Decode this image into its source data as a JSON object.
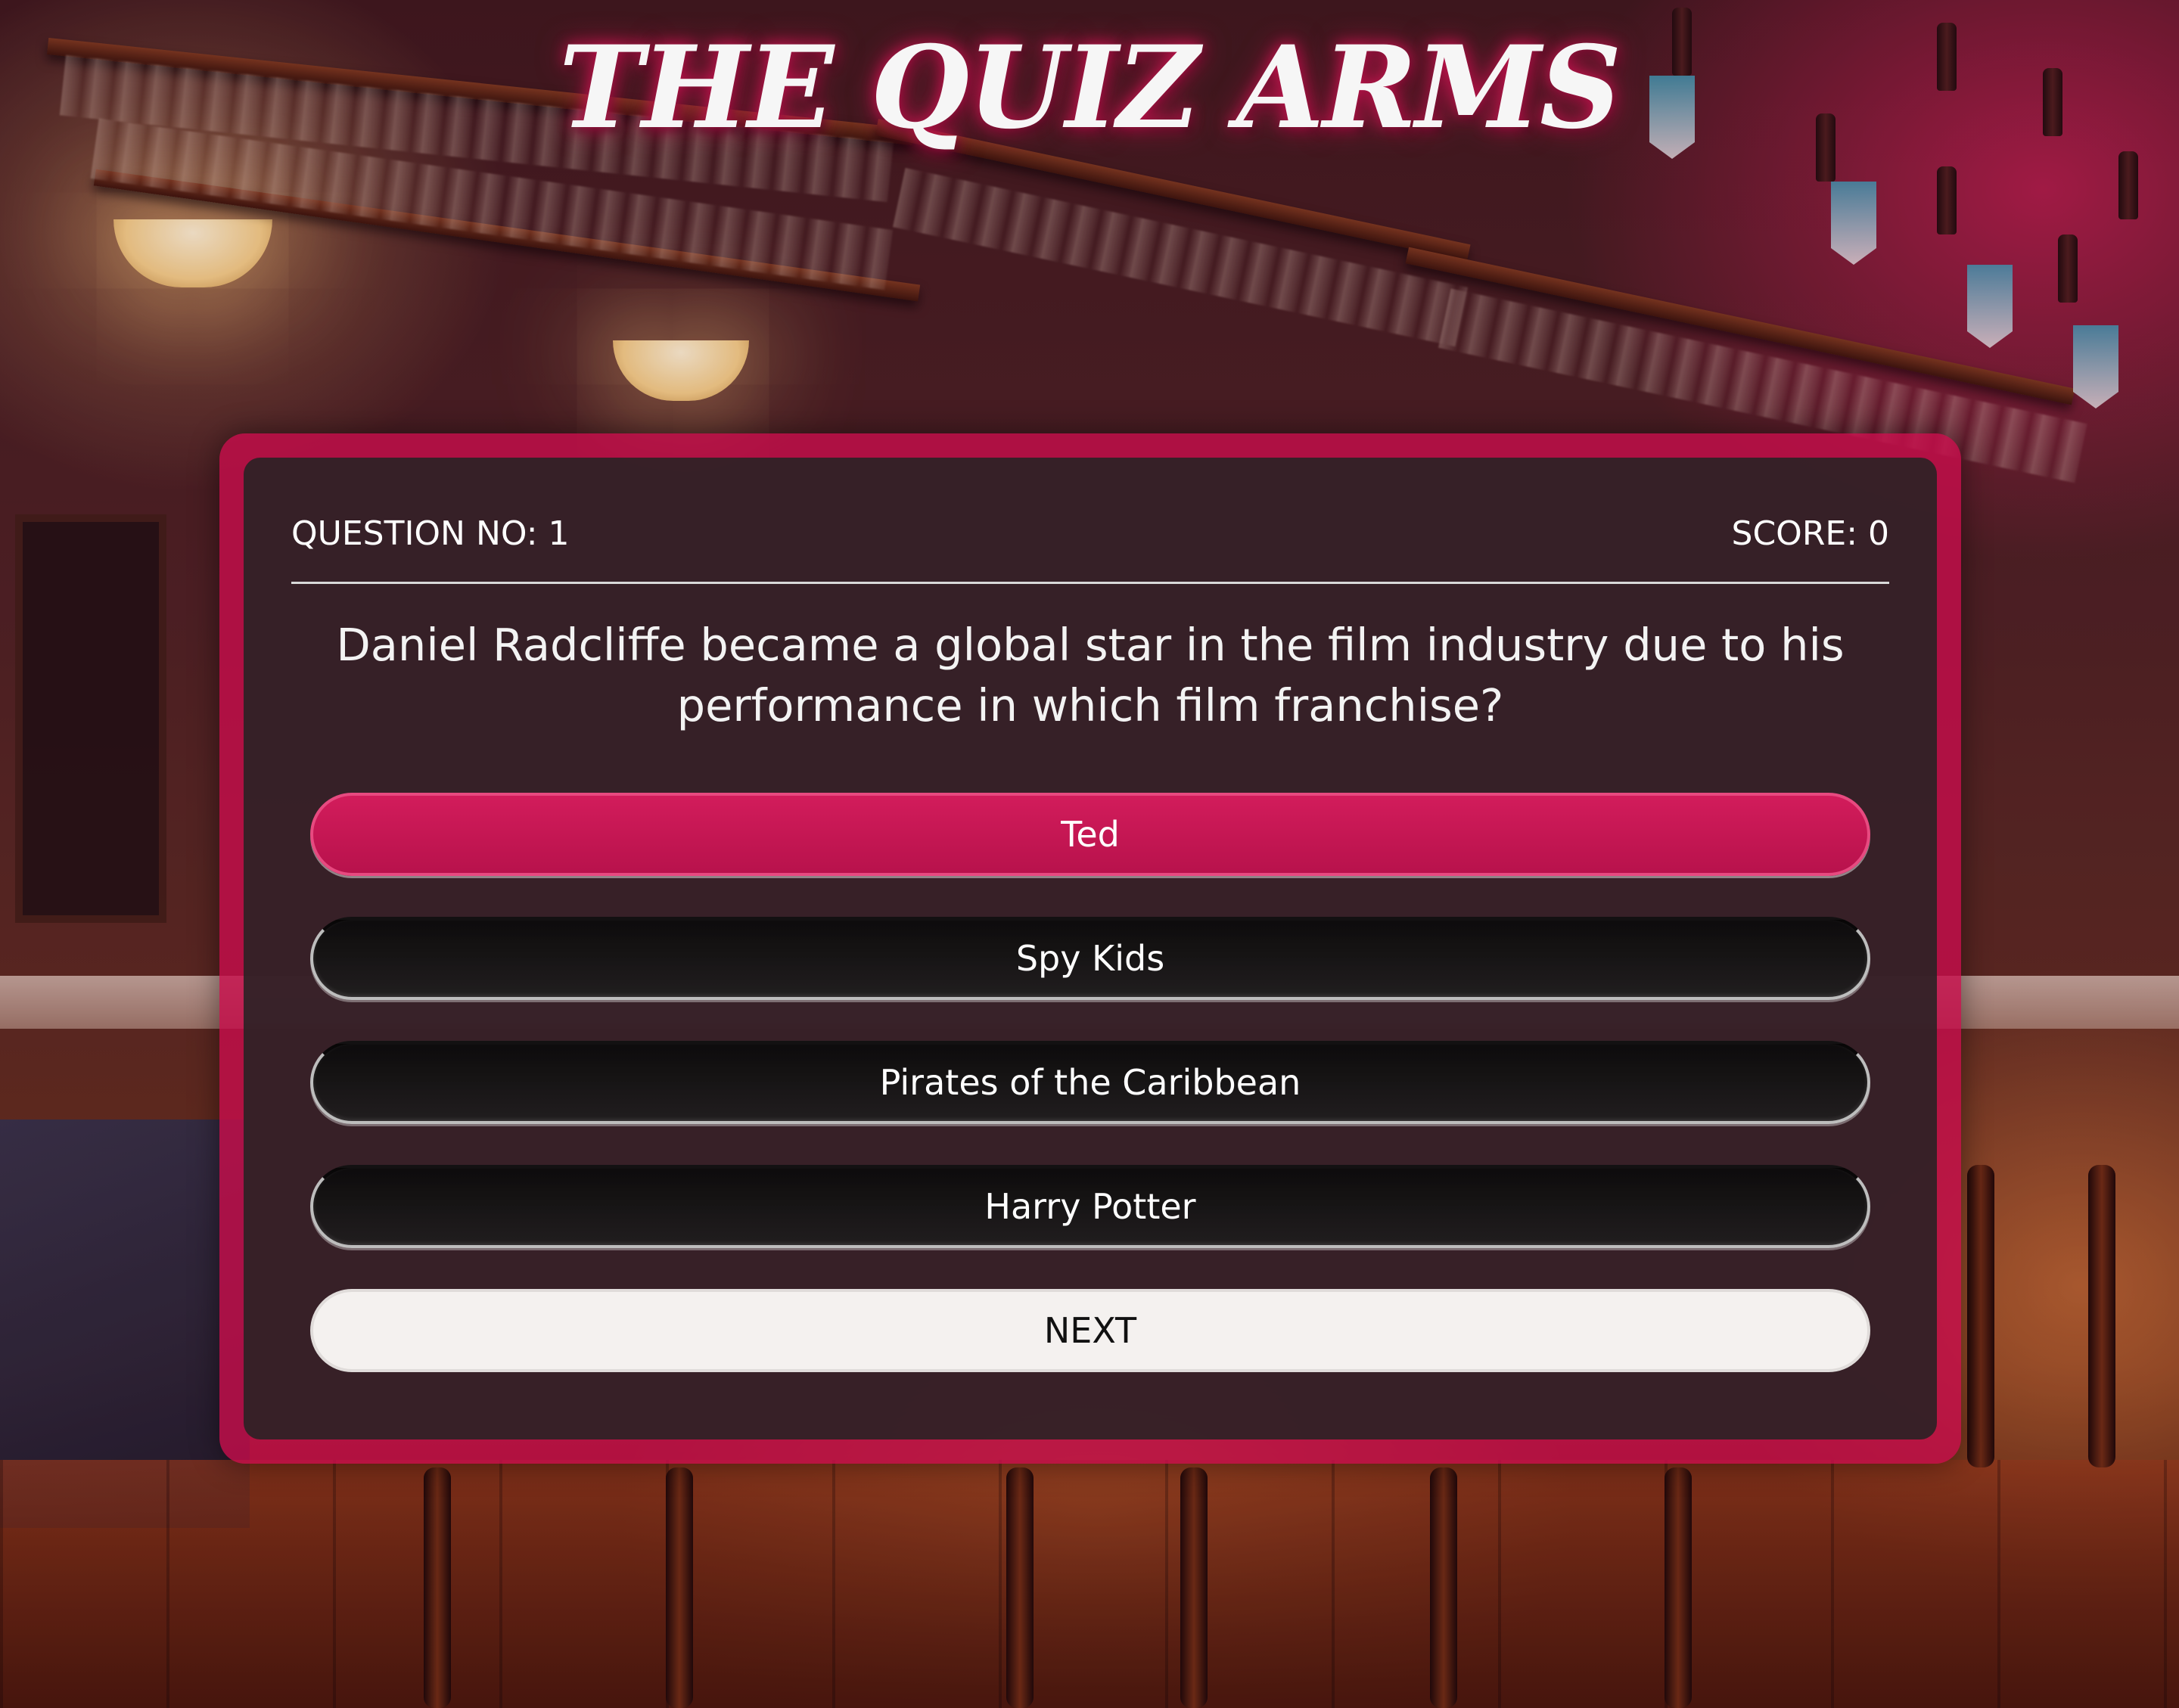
{
  "app": {
    "title": "THE QUIZ ARMS"
  },
  "quiz": {
    "question_number_label": "QUESTION NO: 1",
    "score_label": "SCORE: 0",
    "question_text": "Daniel Radcliffe became a global star in the film industry due to his performance in which film franchise?",
    "answers": [
      {
        "label": "Ted",
        "state": "selected"
      },
      {
        "label": "Spy Kids",
        "state": "default"
      },
      {
        "label": "Pirates of the Caribbean",
        "state": "default"
      },
      {
        "label": "Harry Potter",
        "state": "default"
      }
    ],
    "next_label": "NEXT"
  },
  "colors": {
    "accent": "#c40e4a",
    "card": "#262223",
    "next_button": "#f4f1ef"
  }
}
